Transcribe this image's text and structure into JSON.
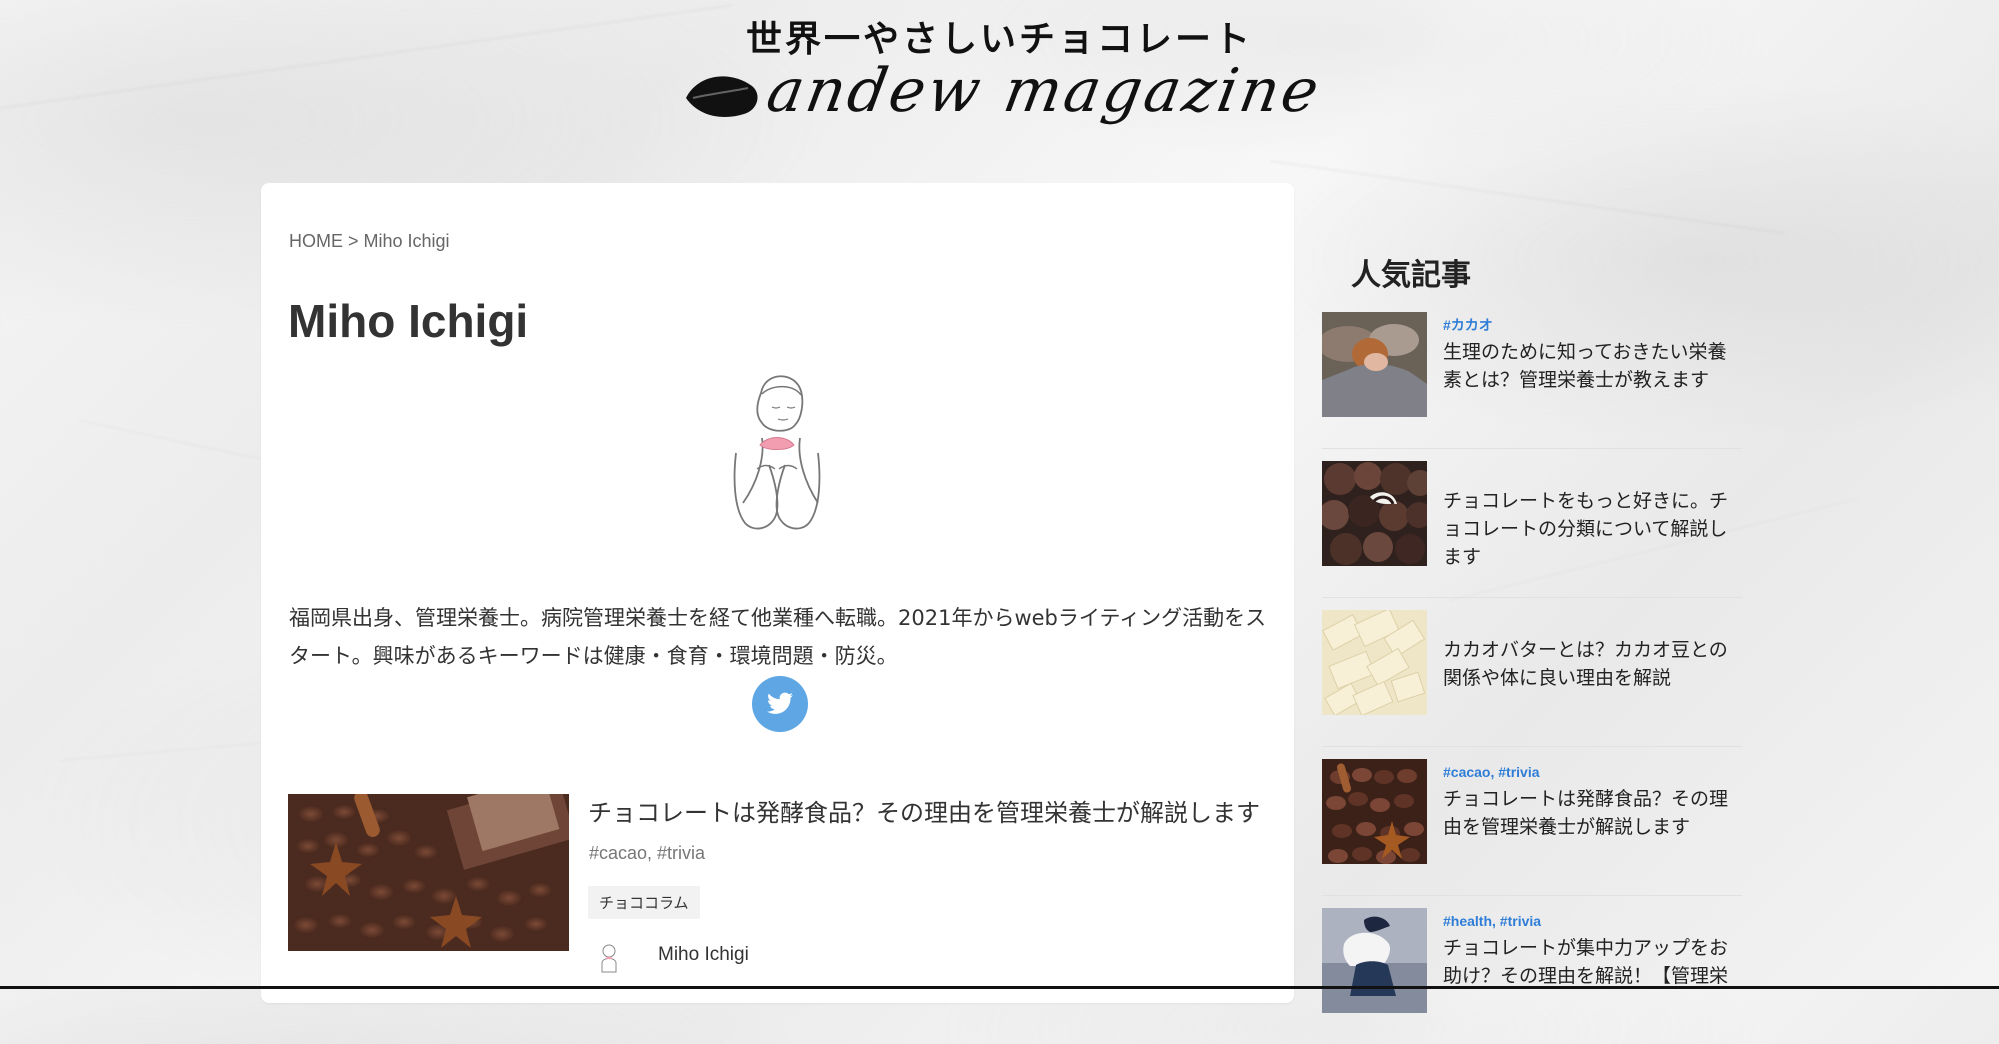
{
  "header": {
    "tagline": "世界一やさしいチョコレート",
    "logo_text": "andew magazine"
  },
  "main": {
    "breadcrumb": "HOME > Miho Ichigi",
    "title": "Miho Ichigi",
    "bio": "福岡県出身、管理栄養士。病院管理栄養士を経て他業種へ転職。2021年からwebライティング活動をスタート。興味があるキーワードは健康・食育・環境問題・防災。",
    "twitter_icon": "twitter-icon",
    "post": {
      "title": "チョコレートは発酵食品？その理由を管理栄養士が解説します",
      "tags": "#cacao, #trivia",
      "category": "チョココラム",
      "author": "Miho Ichigi"
    }
  },
  "sidebar": {
    "title": "人気記事",
    "items": [
      {
        "tags": "#カカオ",
        "title": "生理のために知っておきたい栄養素とは？管理栄養士が教えます"
      },
      {
        "tags": "",
        "title": "チョコレートをもっと好きに。チョコレートの分類について解説します"
      },
      {
        "tags": "",
        "title": "カカオバターとは？カカオ豆との関係や体に良い理由を解説"
      },
      {
        "tags": "#cacao, #trivia",
        "title": "チョコレートは発酵食品？その理由を管理栄養士が解説します"
      },
      {
        "tags": "#health, #trivia",
        "title": "チョコレートが集中力アップをお助け？その理由を解説！【管理栄"
      }
    ]
  },
  "colors": {
    "accent": "#5ea6e4",
    "tag_blue": "#2e7dd7",
    "text_dark": "#222222"
  }
}
